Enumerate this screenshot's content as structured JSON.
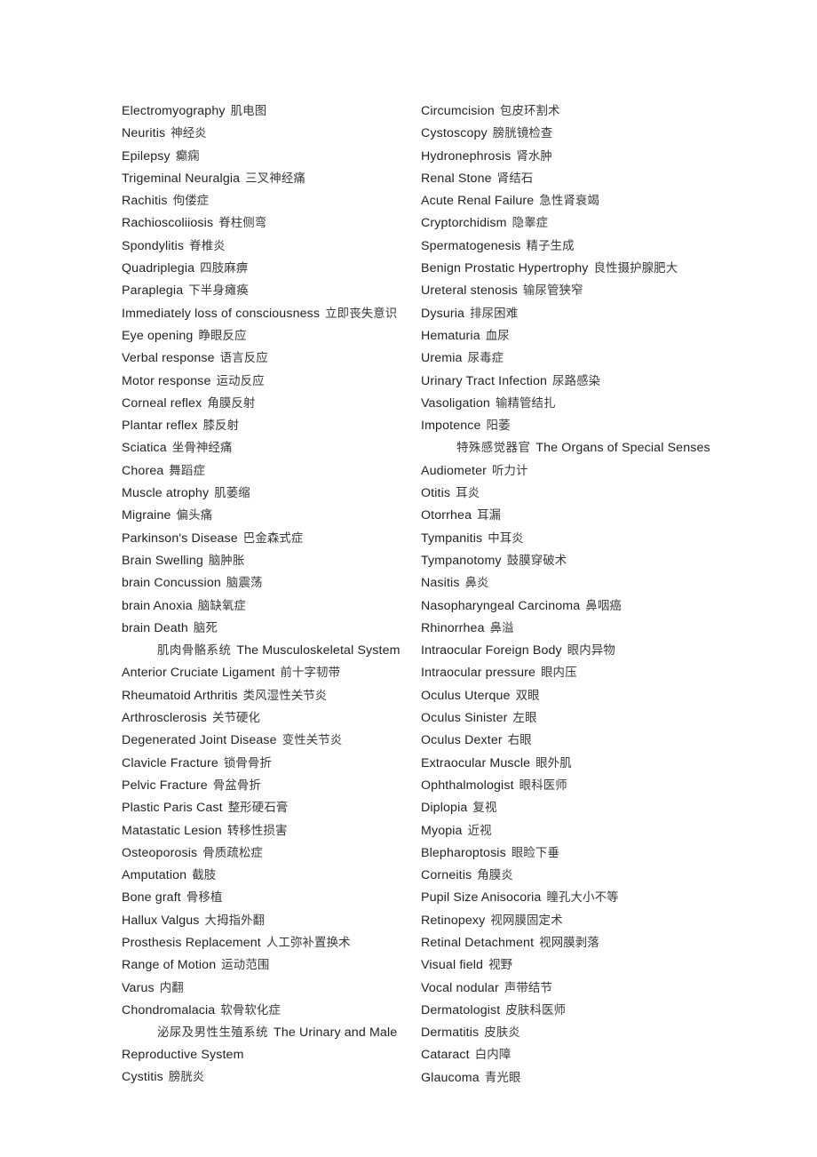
{
  "document": {
    "type": "bilingual-glossary",
    "language_pair": "English-Chinese",
    "background_color": "#ffffff",
    "text_color": "#231f20"
  },
  "left_column": [
    {
      "kind": "entry",
      "en": "Electromyography",
      "zh": "肌电图"
    },
    {
      "kind": "entry",
      "en": "Neuritis",
      "zh": "神经炎"
    },
    {
      "kind": "entry",
      "en": "Epilepsy",
      "zh": "癫痫"
    },
    {
      "kind": "entry",
      "en": "Trigeminal Neuralgia",
      "zh": "三叉神经痛"
    },
    {
      "kind": "entry",
      "en": "Rachitis",
      "zh": "佝偻症"
    },
    {
      "kind": "entry",
      "en": "Rachioscoliiosis",
      "zh": "脊柱侧弯"
    },
    {
      "kind": "entry",
      "en": "Spondylitis",
      "zh": "脊椎炎"
    },
    {
      "kind": "entry",
      "en": "Quadriplegia",
      "zh": "四肢麻痹"
    },
    {
      "kind": "entry",
      "en": "Paraplegia",
      "zh": "下半身瘫痪"
    },
    {
      "kind": "entry",
      "en": "Immediately loss of consciousness",
      "zh": "立即丧失意识"
    },
    {
      "kind": "entry",
      "en": "Eye opening",
      "zh": "睁眼反应"
    },
    {
      "kind": "entry",
      "en": "Verbal response",
      "zh": "语言反应"
    },
    {
      "kind": "entry",
      "en": "Motor response",
      "zh": "运动反应"
    },
    {
      "kind": "entry",
      "en": "Corneal reflex",
      "zh": "角膜反射"
    },
    {
      "kind": "entry",
      "en": "Plantar reflex",
      "zh": "膝反射"
    },
    {
      "kind": "entry",
      "en": "Sciatica",
      "zh": "坐骨神经痛"
    },
    {
      "kind": "entry",
      "en": "Chorea",
      "zh": "舞蹈症"
    },
    {
      "kind": "entry",
      "en": "Muscle atrophy",
      "zh": "肌萎缩"
    },
    {
      "kind": "entry",
      "en": "Migraine",
      "zh": "偏头痛"
    },
    {
      "kind": "entry",
      "en": "Parkinson's Disease",
      "zh": "巴金森式症"
    },
    {
      "kind": "entry",
      "en": "Brain Swelling",
      "zh": "脑肿胀"
    },
    {
      "kind": "entry",
      "en": "brain Concussion",
      "zh": "脑震荡"
    },
    {
      "kind": "entry",
      "en": "brain Anoxia",
      "zh": "脑缺氧症"
    },
    {
      "kind": "entry",
      "en": "brain Death",
      "zh": "脑死"
    },
    {
      "kind": "section",
      "zh": "肌肉骨骼系统",
      "en": "The Musculoskeletal System"
    },
    {
      "kind": "entry",
      "en": "Anterior Cruciate Ligament",
      "zh": "前十字韧带"
    },
    {
      "kind": "entry",
      "en": "Rheumatoid Arthritis",
      "zh": "类风湿性关节炎"
    },
    {
      "kind": "entry",
      "en": "Arthrosclerosis",
      "zh": "关节硬化"
    },
    {
      "kind": "entry",
      "en": "Degenerated Joint Disease",
      "zh": "变性关节炎"
    },
    {
      "kind": "entry",
      "en": "Clavicle Fracture",
      "zh": "锁骨骨折"
    },
    {
      "kind": "entry",
      "en": "Pelvic Fracture",
      "zh": "骨盆骨折"
    },
    {
      "kind": "entry",
      "en": "Plastic Paris Cast",
      "zh": "整形硬石膏"
    },
    {
      "kind": "entry",
      "en": "Matastatic Lesion",
      "zh": "转移性损害"
    },
    {
      "kind": "entry",
      "en": "Osteoporosis",
      "zh": "骨质疏松症"
    },
    {
      "kind": "entry",
      "en": "Amputation",
      "zh": "截肢"
    },
    {
      "kind": "entry",
      "en": "Bone graft",
      "zh": "骨移植"
    },
    {
      "kind": "entry",
      "en": "Hallux Valgus",
      "zh": "大拇指外翻"
    },
    {
      "kind": "entry",
      "en": "Prosthesis Replacement",
      "zh": "人工弥补置换术"
    },
    {
      "kind": "entry",
      "en": "Range of Motion",
      "zh": "运动范围"
    },
    {
      "kind": "entry",
      "en": "Varus",
      "zh": "内翻"
    },
    {
      "kind": "entry",
      "en": "Chondromalacia",
      "zh": "软骨软化症"
    },
    {
      "kind": "section",
      "zh": "泌尿及男性生殖系统",
      "en": "The Urinary and Male"
    },
    {
      "kind": "continuation",
      "en": "Reproductive System",
      "zh": ""
    },
    {
      "kind": "entry",
      "en": "Cystitis",
      "zh": "膀胱炎"
    }
  ],
  "right_column": [
    {
      "kind": "entry",
      "en": "Circumcision",
      "zh": "包皮环割术"
    },
    {
      "kind": "entry",
      "en": "Cystoscopy",
      "zh": "膀胱镜检查"
    },
    {
      "kind": "entry",
      "en": "Hydronephrosis",
      "zh": "肾水肿"
    },
    {
      "kind": "entry",
      "en": "Renal Stone",
      "zh": "肾结石"
    },
    {
      "kind": "entry",
      "en": "Acute Renal Failure",
      "zh": "急性肾衰竭"
    },
    {
      "kind": "entry",
      "en": "Cryptorchidism",
      "zh": "隐睾症"
    },
    {
      "kind": "entry",
      "en": "Spermatogenesis",
      "zh": "精子生成"
    },
    {
      "kind": "entry",
      "en": "Benign Prostatic Hypertrophy",
      "zh": "良性摄护腺肥大"
    },
    {
      "kind": "entry",
      "en": "Ureteral stenosis",
      "zh": "输尿管狭窄"
    },
    {
      "kind": "entry",
      "en": "Dysuria",
      "zh": "排尿困难"
    },
    {
      "kind": "entry",
      "en": "Hematuria",
      "zh": "血尿"
    },
    {
      "kind": "entry",
      "en": "Uremia",
      "zh": "尿毒症"
    },
    {
      "kind": "entry",
      "en": "Urinary Tract Infection",
      "zh": "尿路感染"
    },
    {
      "kind": "entry",
      "en": "Vasoligation",
      "zh": "输精管结扎"
    },
    {
      "kind": "entry",
      "en": "Impotence",
      "zh": "阳萎"
    },
    {
      "kind": "section",
      "zh": "特殊感觉器官",
      "en": "The Organs of Special Senses"
    },
    {
      "kind": "entry",
      "en": "Audiometer",
      "zh": "听力计"
    },
    {
      "kind": "entry",
      "en": "Otitis",
      "zh": "耳炎"
    },
    {
      "kind": "entry",
      "en": "Otorrhea",
      "zh": "耳漏"
    },
    {
      "kind": "entry",
      "en": "Tympanitis",
      "zh": "中耳炎"
    },
    {
      "kind": "entry",
      "en": "Tympanotomy",
      "zh": "鼓膜穿破术"
    },
    {
      "kind": "entry",
      "en": "Nasitis",
      "zh": "鼻炎"
    },
    {
      "kind": "entry",
      "en": "Nasopharyngeal Carcinoma",
      "zh": "鼻咽癌"
    },
    {
      "kind": "entry",
      "en": "Rhinorrhea",
      "zh": "鼻溢"
    },
    {
      "kind": "entry",
      "en": "Intraocular Foreign Body",
      "zh": "眼内异物"
    },
    {
      "kind": "entry",
      "en": "Intraocular pressure",
      "zh": "眼内压"
    },
    {
      "kind": "entry",
      "en": "Oculus Uterque",
      "zh": "双眼"
    },
    {
      "kind": "entry",
      "en": "Oculus Sinister",
      "zh": "左眼"
    },
    {
      "kind": "entry",
      "en": "Oculus Dexter",
      "zh": "右眼"
    },
    {
      "kind": "entry",
      "en": "Extraocular Muscle",
      "zh": "眼外肌"
    },
    {
      "kind": "entry",
      "en": "Ophthalmologist",
      "zh": "眼科医师"
    },
    {
      "kind": "entry",
      "en": "Diplopia",
      "zh": "复视"
    },
    {
      "kind": "entry",
      "en": "Myopia",
      "zh": "近视"
    },
    {
      "kind": "entry",
      "en": "Blepharoptosis",
      "zh": "眼睑下垂"
    },
    {
      "kind": "entry",
      "en": "Corneitis",
      "zh": "角膜炎"
    },
    {
      "kind": "entry",
      "en": "Pupil Size Anisocoria",
      "zh": "瞳孔大小不等"
    },
    {
      "kind": "entry",
      "en": "Retinopexy",
      "zh": "视网膜固定术"
    },
    {
      "kind": "entry",
      "en": "Retinal Detachment",
      "zh": "视网膜剥落"
    },
    {
      "kind": "entry",
      "en": "Visual field",
      "zh": "视野"
    },
    {
      "kind": "entry",
      "en": "Vocal nodular",
      "zh": "声带结节"
    },
    {
      "kind": "entry",
      "en": "Dermatologist",
      "zh": "皮肤科医师"
    },
    {
      "kind": "entry",
      "en": "Dermatitis",
      "zh": "皮肤炎"
    },
    {
      "kind": "entry",
      "en": "Cataract",
      "zh": "白内障"
    },
    {
      "kind": "entry",
      "en": "Glaucoma",
      "zh": "青光眼"
    }
  ]
}
